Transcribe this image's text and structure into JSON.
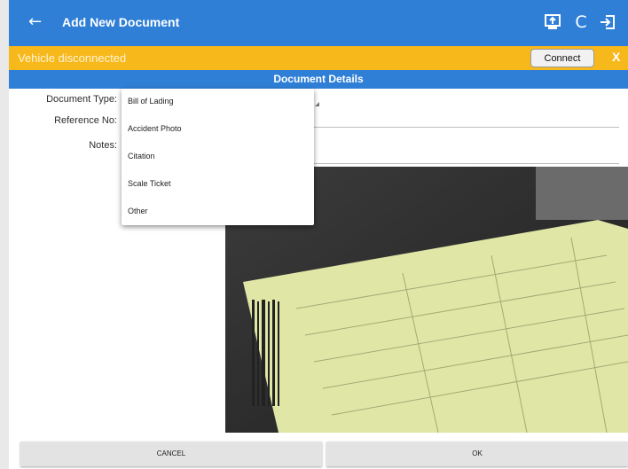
{
  "appbar": {
    "back_icon": "←",
    "title": "Add New Document",
    "actions": [
      "upload-icon",
      "refresh-icon",
      "logout-icon"
    ],
    "refresh_glyph": "C"
  },
  "banner": {
    "message": "Vehicle disconnected",
    "connect_label": "Connect",
    "close_label": "X"
  },
  "section": {
    "title": "Document Details"
  },
  "form": {
    "document_type_label": "Document Type:",
    "reference_label": "Reference No:",
    "notes_label": "Notes:"
  },
  "dropdown": {
    "options": [
      "Bill of Lading",
      "Accident Photo",
      "Citation",
      "Scale Ticket",
      "Other"
    ]
  },
  "buttons": {
    "cancel": "CANCEL",
    "ok": "OK"
  },
  "colors": {
    "primary": "#2f7fd6",
    "banner": "#f7b81c",
    "paper": "#dfe6a6"
  }
}
